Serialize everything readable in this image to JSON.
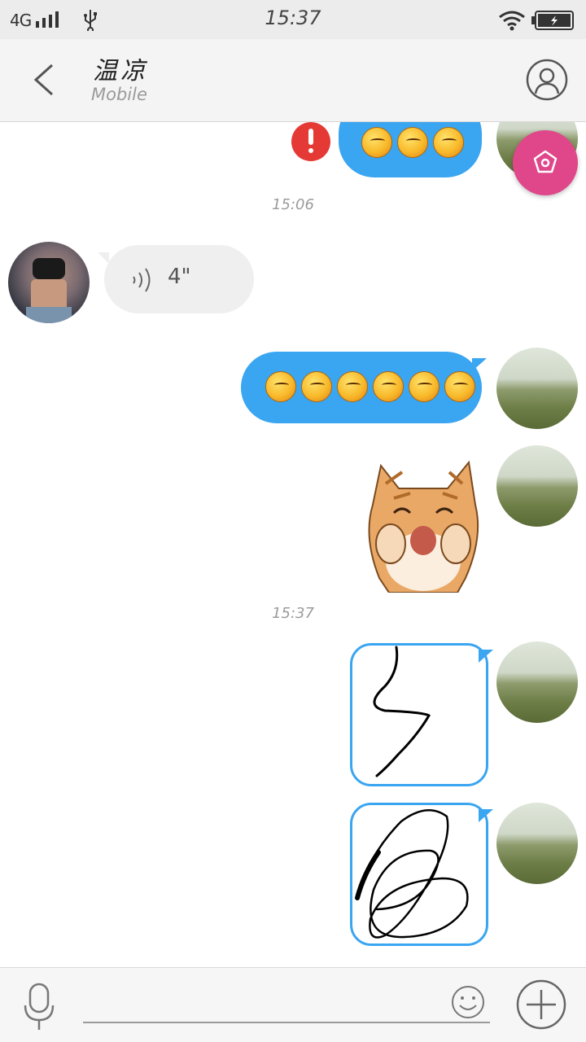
{
  "status_bar": {
    "network": "4G",
    "time": "15:37"
  },
  "header": {
    "contact_name": "温凉",
    "contact_subtitle": "Mobile"
  },
  "messages": {
    "timestamp_1": "15:06",
    "timestamp_2": "15:37",
    "voice_duration": "4\""
  },
  "icons": {
    "back": "chevron-left-icon",
    "profile": "person-outline-icon",
    "floating": "flower-icon",
    "error": "exclamation-icon",
    "voice": "microphone-icon",
    "emoji": "smiley-icon",
    "add": "plus-icon"
  },
  "colors": {
    "bubble_blue": "#3aa5f1",
    "bubble_grey": "#efefef",
    "fab_pink": "#e0478a",
    "error_red": "#e53935"
  }
}
